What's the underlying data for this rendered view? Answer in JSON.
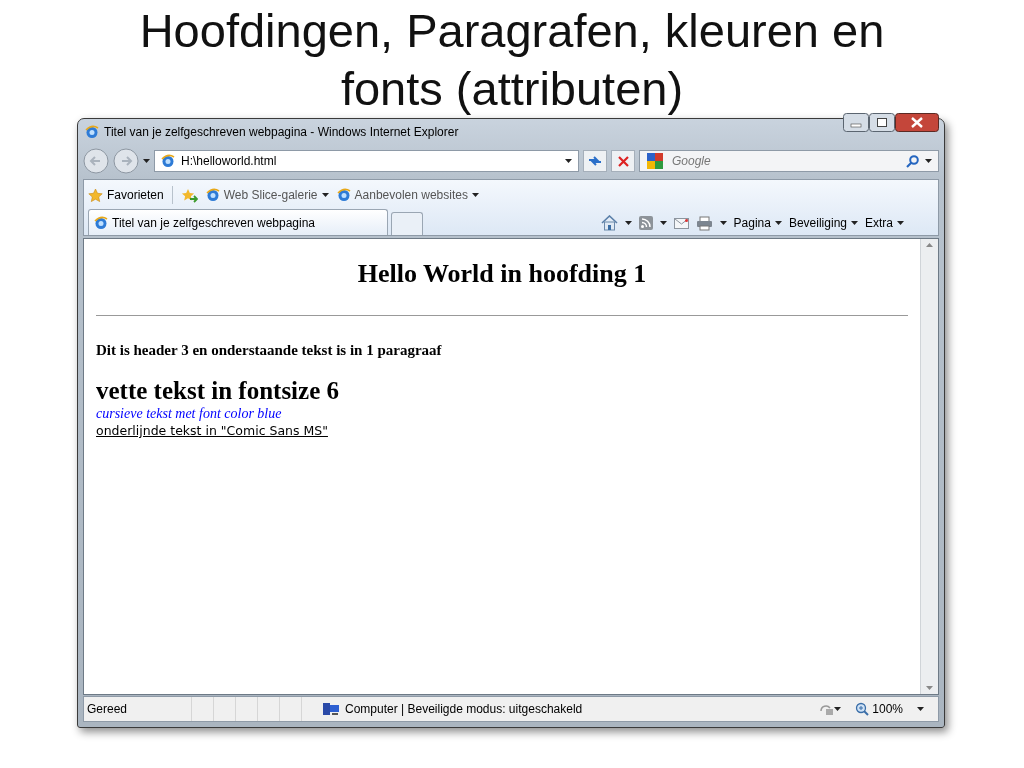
{
  "slide": {
    "title": "Hoofdingen, Paragrafen, kleuren en fonts (attributen)"
  },
  "window": {
    "title": "Titel van je zelfgeschreven webpagina - Windows Internet Explorer"
  },
  "address_bar": {
    "value": "H:\\helloworld.html"
  },
  "search": {
    "placeholder": "Google"
  },
  "favorites_bar": {
    "label": "Favorieten",
    "items": [
      {
        "label": "Web Slice-galerie"
      },
      {
        "label": "Aanbevolen websites"
      }
    ]
  },
  "tabs": [
    {
      "label": "Titel van je zelfgeschreven webpagina",
      "selected": true
    }
  ],
  "command_bar": [
    "Pagina",
    "Beveiliging",
    "Extra"
  ],
  "page": [
    {
      "kind": "heading1",
      "text": "Hello World in hoofding 1"
    },
    {
      "kind": "rule"
    },
    {
      "kind": "heading3",
      "text": "Dit is header 3 en onderstaande tekst is in 1 paragraaf"
    },
    {
      "kind": "big-bold",
      "text": "vette tekst in fontsize 6"
    },
    {
      "kind": "italic",
      "text": "cursieve tekst met font color blue"
    },
    {
      "kind": "underlined",
      "text": "onderlijnde tekst in \"Comic Sans MS\""
    }
  ],
  "status_bar": {
    "text": "Gereed",
    "zone": "Computer | Beveiligde modus: uitgeschakeld",
    "zoom": "100%"
  }
}
